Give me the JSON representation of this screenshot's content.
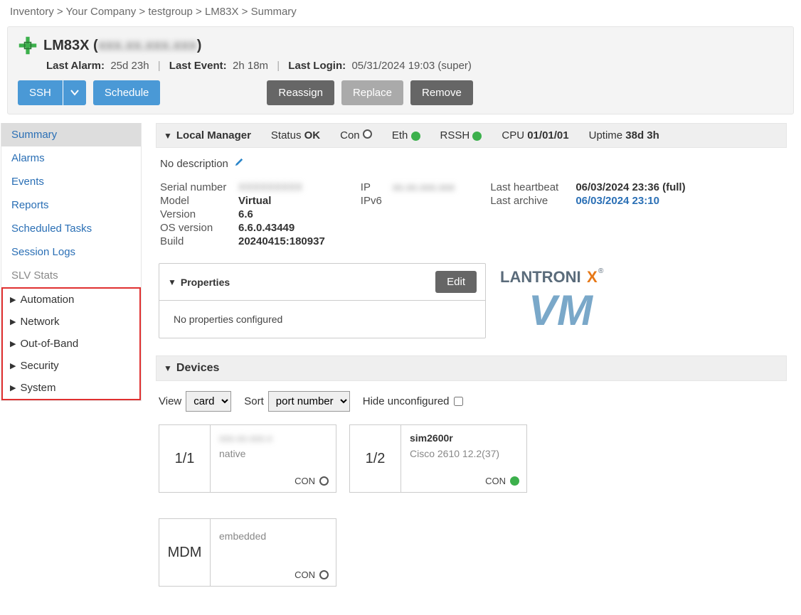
{
  "breadcrumb": {
    "items": [
      "Inventory",
      "Your Company",
      "testgroup",
      "LM83X",
      "Summary"
    ]
  },
  "header": {
    "device_name": "LM83X",
    "device_ip_masked": "xxx.xx.xxx.xxx",
    "last_alarm_label": "Last Alarm:",
    "last_alarm_value": "25d 23h",
    "last_event_label": "Last Event:",
    "last_event_value": "2h 18m",
    "last_login_label": "Last Login:",
    "last_login_value": "05/31/2024 19:03 (super)"
  },
  "buttons": {
    "ssh": "SSH",
    "schedule": "Schedule",
    "reassign": "Reassign",
    "replace": "Replace",
    "remove": "Remove",
    "edit": "Edit"
  },
  "sidebar": {
    "items": [
      "Summary",
      "Alarms",
      "Events",
      "Reports",
      "Scheduled Tasks",
      "Session Logs",
      "SLV Stats"
    ],
    "exp": [
      "Automation",
      "Network",
      "Out-of-Band",
      "Security",
      "System"
    ]
  },
  "status": {
    "title": "Local Manager",
    "status_label": "Status",
    "status_value": "OK",
    "con_label": "Con",
    "eth_label": "Eth",
    "rssh_label": "RSSH",
    "cpu_label": "CPU",
    "cpu_value": "01/01/01",
    "uptime_label": "Uptime",
    "uptime_value": "38d 3h"
  },
  "description": {
    "text": "No description"
  },
  "details": {
    "serial_label": "Serial number",
    "serial_value": "XXXXXXXXX",
    "model_label": "Model",
    "model_value": "Virtual",
    "version_label": "Version",
    "version_value": "6.6",
    "os_label": "OS version",
    "os_value": "6.6.0.43449",
    "build_label": "Build",
    "build_value": "20240415:180937",
    "ip_label": "IP",
    "ip_value": "xx.xx.xxx.xxx",
    "ipv6_label": "IPv6",
    "ipv6_value": "",
    "hb_label": "Last heartbeat",
    "hb_value": "06/03/2024 23:36 (full)",
    "archive_label": "Last archive",
    "archive_value": "06/03/2024 23:10"
  },
  "properties": {
    "title": "Properties",
    "empty": "No properties configured"
  },
  "devices": {
    "title": "Devices",
    "view_label": "View",
    "view_value": "card",
    "sort_label": "Sort",
    "sort_value": "port number",
    "hide_label": "Hide unconfigured",
    "cards": [
      {
        "port": "1/1",
        "name": "xxx.xx.xxx.x",
        "name_blur": true,
        "sub": "native",
        "con": "CON",
        "status": "empty"
      },
      {
        "port": "1/2",
        "name": "sim2600r",
        "name_blur": false,
        "sub": "Cisco 2610 12.2(37)",
        "con": "CON",
        "status": "green"
      },
      {
        "port": "MDM",
        "name": "",
        "name_blur": false,
        "sub": "embedded",
        "con": "CON",
        "status": "empty"
      }
    ]
  }
}
